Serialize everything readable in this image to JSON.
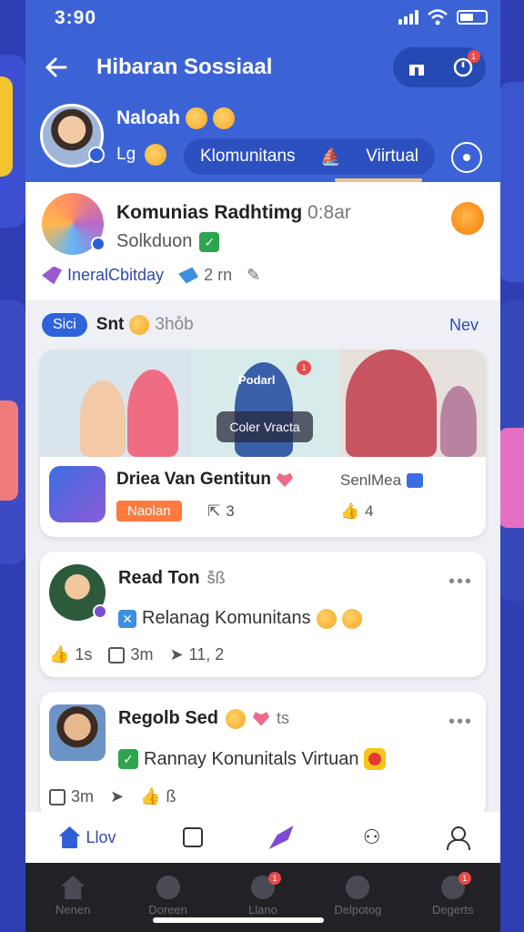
{
  "status": {
    "time": "3:90"
  },
  "header": {
    "title": "Hibaran Sossiaal",
    "user_name": "Naloah",
    "user_sub": "Lg",
    "tab_label": "Klomunitans",
    "tab_active": "Viirtual"
  },
  "post1": {
    "title": "Komunias Radhtimg",
    "meta": "0:8ar",
    "sub": "Solkduon",
    "action1": "IneralCbitday",
    "action2": "2 rn"
  },
  "section": {
    "chip": "Sici",
    "title": "Snt",
    "title_muted": "3ho̊b",
    "link": "Nev"
  },
  "media_card": {
    "overlay_top": "Podarl",
    "overlay_box": "Coler Vracta",
    "title": "Driea Van Gentitun",
    "tag": "Naolan",
    "stat": "3",
    "right_label": "SenlMea",
    "right_stat": "4"
  },
  "card2": {
    "title": "Read Ton",
    "title_muted": "š̊ß",
    "sub": "Relanag Komunitans",
    "stats": [
      "1s",
      "3m",
      "11, 2"
    ]
  },
  "card3": {
    "title": "Regolb Sed",
    "title_muted": "ts",
    "sub": "Rannay Konunitals Virtuan",
    "stats": [
      "3m",
      "ß"
    ]
  },
  "tabbar": {
    "home_label": "Llov"
  },
  "navbar": [
    "Nenen",
    "Doreen",
    "Llano",
    "Delpotog",
    "Degerts"
  ],
  "colors": {
    "header": "#3c63d6",
    "accent": "#2f4ab0",
    "background": "#2f3fb3"
  }
}
